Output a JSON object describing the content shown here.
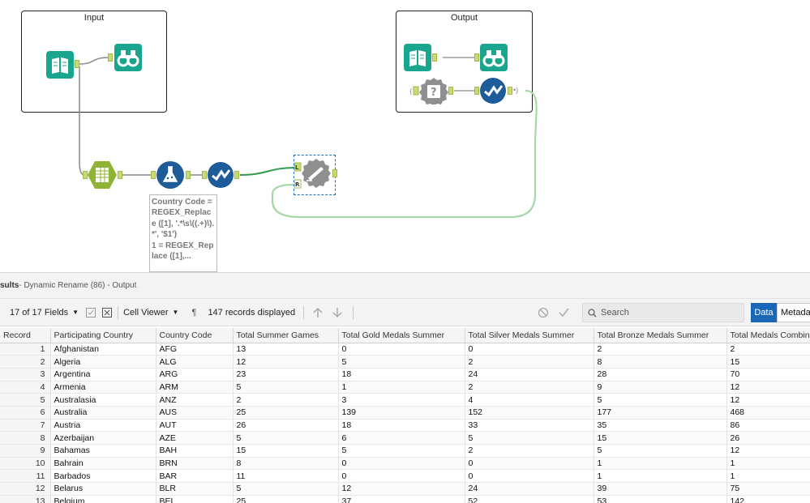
{
  "canvas": {
    "containers": {
      "input_title": "Input",
      "output_title": "Output"
    },
    "annotation": "Country Code = REGEX_Replace ([1], '.*\\s\\((.+)\\).*', '$1')\n1 = REGEX_Replace ([1],...",
    "join_anchors": {
      "left": "L",
      "right": "R"
    },
    "colors": {
      "in_out_tool": "#1aa58e",
      "prep_tool": "#8fb433",
      "dev_tool": "#1d5c99",
      "select_tool": "#1d5c99",
      "disabled_tool": "#8f8f8f",
      "wire_active": "#2f9a49",
      "wire_loop": "#a8d8a8",
      "anchor": "#c6dc6e"
    },
    "tools": [
      {
        "id": "input-data-1",
        "icon": "book-icon"
      },
      {
        "id": "browse-1",
        "icon": "binoculars-icon"
      },
      {
        "id": "input-data-2",
        "icon": "book-icon"
      },
      {
        "id": "browse-2",
        "icon": "binoculars-icon"
      },
      {
        "id": "macro-input",
        "icon": "question-gear-icon"
      },
      {
        "id": "macro-select",
        "icon": "check-circle-icon"
      },
      {
        "id": "text-to-columns",
        "icon": "columns-hex-icon"
      },
      {
        "id": "formula",
        "icon": "flask-icon"
      },
      {
        "id": "select",
        "icon": "check-circle-icon"
      },
      {
        "id": "dynamic-rename",
        "icon": "rename-gear-icon"
      }
    ]
  },
  "results": {
    "header_title": "sults",
    "header_subtitle": " - Dynamic Rename (86) - Output",
    "toolbar": {
      "fields_selector": "17 of 17 Fields",
      "cell_viewer": "Cell Viewer",
      "pilcrow": "¶",
      "records_displayed": "147 records displayed",
      "search_placeholder": "Search",
      "tab_data": "Data",
      "tab_metadata": "Metadata"
    },
    "columns": [
      "Record",
      "Participating Country",
      "Country Code",
      "Total Summer Games",
      "Total Gold Medals Summer",
      "Total Silver Medals Summer",
      "Total Bronze Medals Summer",
      "Total Medals Combined"
    ],
    "rows": [
      [
        "1",
        "Afghanistan",
        "AFG",
        "13",
        "0",
        "0",
        "2",
        "2"
      ],
      [
        "2",
        "Algeria",
        "ALG",
        "12",
        "5",
        "2",
        "8",
        "15"
      ],
      [
        "3",
        "Argentina",
        "ARG",
        "23",
        "18",
        "24",
        "28",
        "70"
      ],
      [
        "4",
        "Armenia",
        "ARM",
        "5",
        "1",
        "2",
        "9",
        "12"
      ],
      [
        "5",
        "Australasia",
        "ANZ",
        "2",
        "3",
        "4",
        "5",
        "12"
      ],
      [
        "6",
        "Australia",
        "AUS",
        "25",
        "139",
        "152",
        "177",
        "468"
      ],
      [
        "7",
        "Austria",
        "AUT",
        "26",
        "18",
        "33",
        "35",
        "86"
      ],
      [
        "8",
        "Azerbaijan",
        "AZE",
        "5",
        "6",
        "5",
        "15",
        "26"
      ],
      [
        "9",
        "Bahamas",
        "BAH",
        "15",
        "5",
        "2",
        "5",
        "12"
      ],
      [
        "10",
        "Bahrain",
        "BRN",
        "8",
        "0",
        "0",
        "1",
        "1"
      ],
      [
        "11",
        "Barbados",
        "BAR",
        "11",
        "0",
        "0",
        "1",
        "1"
      ],
      [
        "12",
        "Belarus",
        "BLR",
        "5",
        "12",
        "24",
        "39",
        "75"
      ],
      [
        "13",
        "Belgium",
        "BEL",
        "25",
        "37",
        "52",
        "53",
        "142"
      ]
    ]
  }
}
